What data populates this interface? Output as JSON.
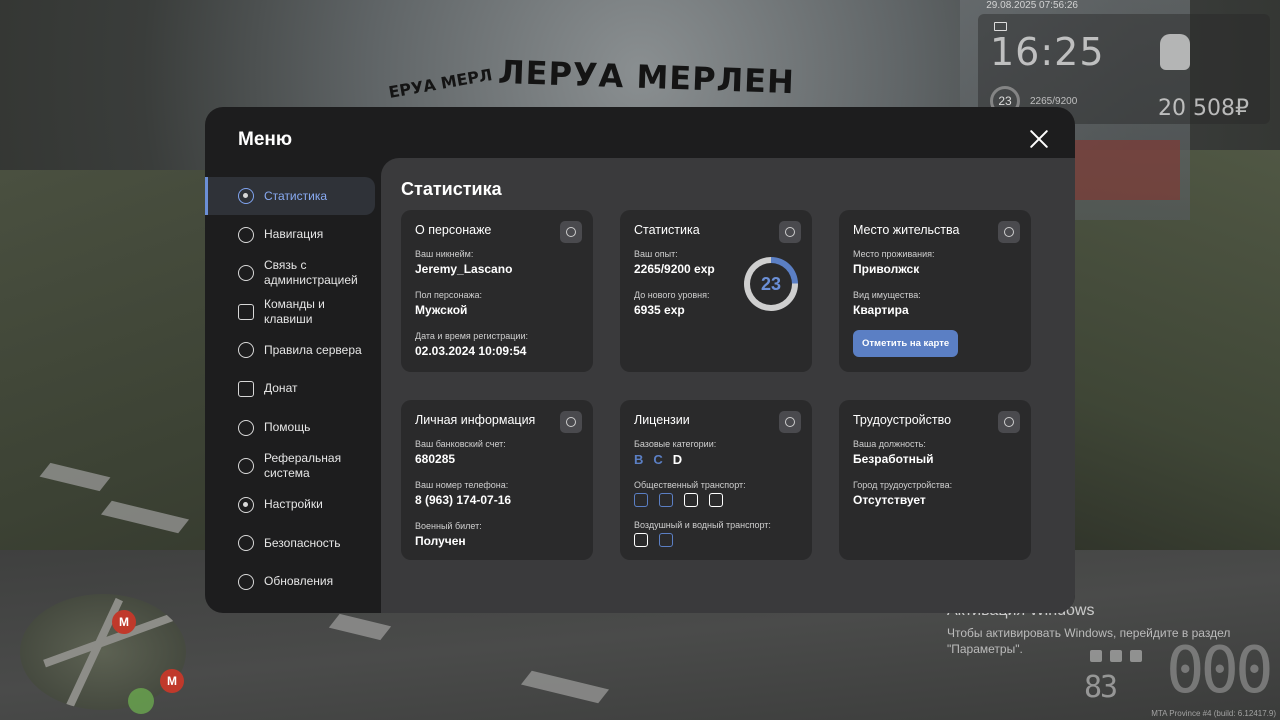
{
  "background": {
    "store_sign": "ЛЕРУА МЕРЛЕН",
    "store_sign_small": "ЕРУА МЕРЛ"
  },
  "hud": {
    "datetime": "29.08.2025 07:56:26",
    "clock": "16:25",
    "level": "23",
    "exp": "2265/9200",
    "money": "20 508₽",
    "fuel": "83",
    "speed": "000",
    "build": "MTA Province #4 (build: 6.12417.9)"
  },
  "activation": {
    "title": "Активация Windows",
    "text": "Чтобы активировать Windows, перейдите в раздел \"Параметры\"."
  },
  "minimap": {
    "metro_label": "М"
  },
  "menu": {
    "title": "Меню",
    "content_title": "Статистика",
    "accent_color": "#5b7fc4",
    "nav": [
      {
        "label": "Статистика",
        "icon": "pie-chart-icon",
        "active": true
      },
      {
        "label": "Навигация",
        "icon": "compass-icon"
      },
      {
        "label": "Связь с администрацией",
        "icon": "headset-icon"
      },
      {
        "label": "Команды и клавиши",
        "icon": "document-icon"
      },
      {
        "label": "Правила сервера",
        "icon": "scales-icon"
      },
      {
        "label": "Донат",
        "icon": "wallet-icon"
      },
      {
        "label": "Помощь",
        "icon": "heart-hand-icon"
      },
      {
        "label": "Реферальная система",
        "icon": "network-icon"
      },
      {
        "label": "Настройки",
        "icon": "gear-icon"
      },
      {
        "label": "Безопасность",
        "icon": "shield-icon"
      },
      {
        "label": "Обновления",
        "icon": "check-circle-icon"
      }
    ]
  },
  "cards": {
    "character": {
      "title": "О персонаже",
      "icon": "user-icon",
      "nick_label": "Ваш никнейм:",
      "nick": "Jeremy_Lascano",
      "gender_label": "Пол персонажа:",
      "gender": "Мужской",
      "reg_label": "Дата и время регистрации:",
      "reg": "02.03.2024 10:09:54"
    },
    "stats": {
      "title": "Статистика",
      "icon": "pie-chart-icon",
      "exp_label": "Ваш опыт:",
      "exp": "2265/9200 exp",
      "next_label": "До нового уровня:",
      "next": "6935 exp",
      "level": "23",
      "progress": 0.246
    },
    "residence": {
      "title": "Место жительства",
      "icon": "home-icon",
      "place_label": "Место проживания:",
      "place": "Приволжск",
      "property_label": "Вид имущества:",
      "property": "Квартира",
      "button": "Отметить на карте"
    },
    "personal": {
      "title": "Личная информация",
      "icon": "face-icon",
      "bank_label": "Ваш банковский счет:",
      "bank": "680285",
      "phone_label": "Ваш номер телефона:",
      "phone": "8 (963) 174-07-16",
      "military_label": "Военный билет:",
      "military": "Получен"
    },
    "licenses": {
      "title": "Лицензии",
      "icon": "id-card-icon",
      "base_label": "Базовые категории:",
      "categories": [
        {
          "letter": "B",
          "owned": false
        },
        {
          "letter": "C",
          "owned": false
        },
        {
          "letter": "D",
          "owned": true
        }
      ],
      "public_label": "Общественный транспорт:",
      "public_icons": [
        {
          "icon": "bus-icon",
          "owned": false
        },
        {
          "icon": "trolleybus-icon",
          "owned": false
        },
        {
          "icon": "tram-icon",
          "owned": true
        },
        {
          "icon": "taxi-icon",
          "owned": true
        }
      ],
      "air_label": "Воздушный и водный транспорт:",
      "air_icons": [
        {
          "icon": "plane-icon",
          "owned": true
        },
        {
          "icon": "boat-icon",
          "owned": false
        }
      ]
    },
    "employment": {
      "title": "Трудоустройство",
      "icon": "tools-icon",
      "position_label": "Ваша должность:",
      "position": "Безработный",
      "city_label": "Город трудоустройства:",
      "city": "Отсутствует"
    }
  }
}
